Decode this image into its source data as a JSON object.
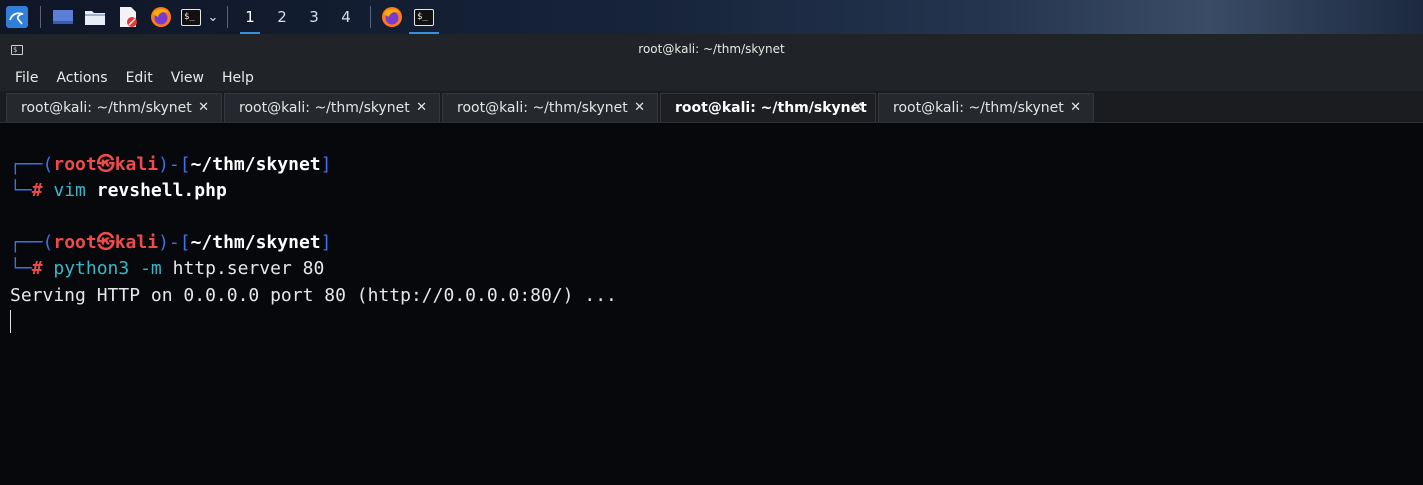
{
  "taskbar": {
    "workspaces": [
      "1",
      "2",
      "3",
      "4"
    ],
    "active_workspace": "1",
    "terminal_glyph": "$_",
    "dropdown_glyph": "⌄"
  },
  "window": {
    "title": "root@kali: ~/thm/skynet"
  },
  "menu": [
    "File",
    "Actions",
    "Edit",
    "View",
    "Help"
  ],
  "tabs": [
    {
      "label": "root@kali: ~/thm/skynet",
      "active": false
    },
    {
      "label": "root@kali: ~/thm/skynet",
      "active": false
    },
    {
      "label": "root@kali: ~/thm/skynet",
      "active": false
    },
    {
      "label": "root@kali: ~/thm/skynet",
      "active": true
    },
    {
      "label": "root@kali: ~/thm/skynet",
      "active": false
    }
  ],
  "tab_close_glyph": "✕",
  "terminal": {
    "prompt1": {
      "open": "┌──(",
      "user": "root㉿kali",
      "close": ")-[",
      "path": "~/thm/skynet",
      "end": "]",
      "hash_prefix": "└─",
      "hash": "#",
      "cmd_name": "vim",
      "cmd_args": "revshell.php"
    },
    "prompt2": {
      "open": "┌──(",
      "user": "root㉿kali",
      "close": ")-[",
      "path": "~/thm/skynet",
      "end": "]",
      "hash_prefix": "└─",
      "hash": "#",
      "cmd_name": "python3",
      "cmd_flag": "-m",
      "cmd_args": "http.server 80"
    },
    "output": "Serving HTTP on 0.0.0.0 port 80 (http://0.0.0.0:80/) ..."
  }
}
